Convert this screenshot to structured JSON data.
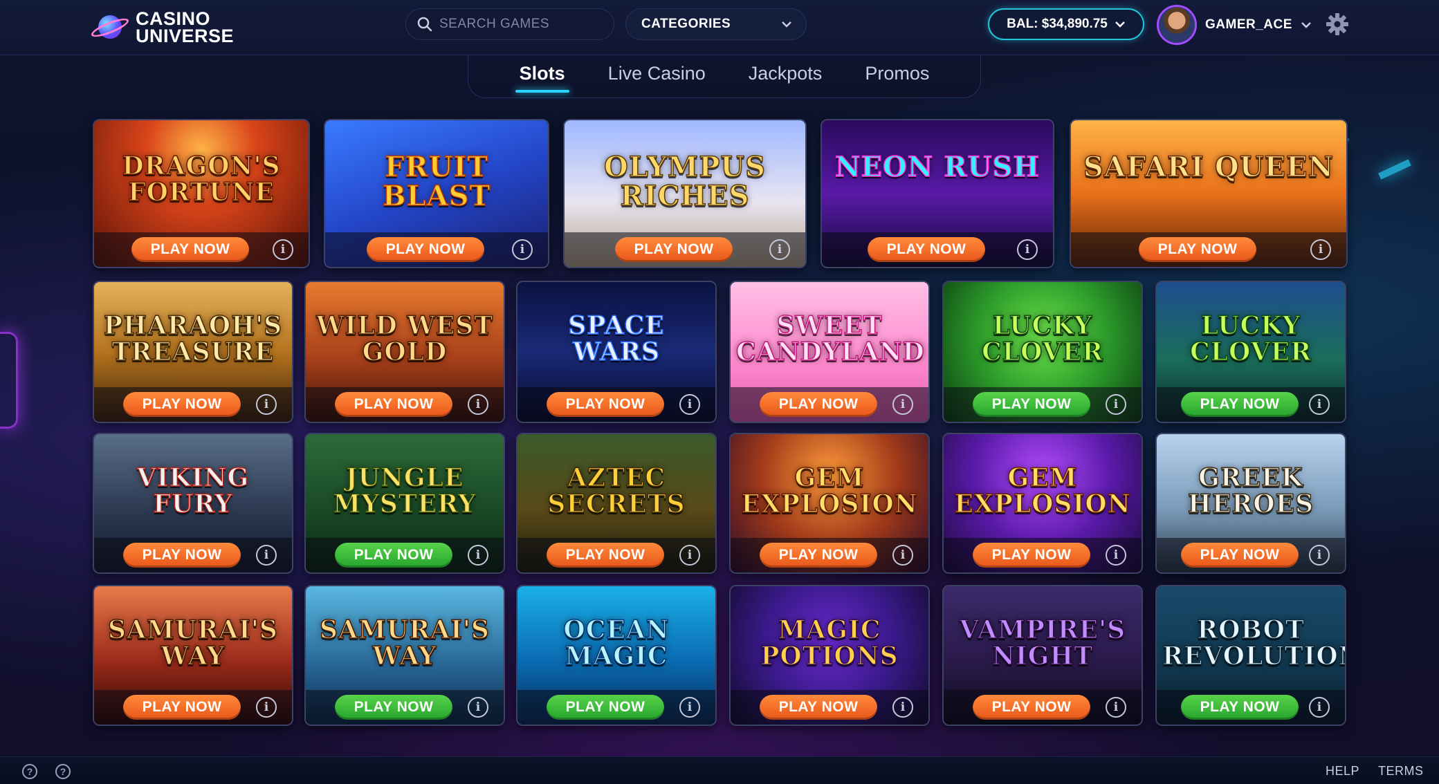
{
  "header": {
    "logo_line1": "CASINO",
    "logo_line2": "UNIVERSE",
    "search_placeholder": "SEARCH GAMES",
    "categories_label": "CATEGORIES",
    "balance": "BAL: $34,890.75",
    "username": "GAMER_ACE"
  },
  "tabs": [
    {
      "label": "Slots",
      "active": true
    },
    {
      "label": "Live Casino",
      "active": false
    },
    {
      "label": "Jackpots",
      "active": false
    },
    {
      "label": "Promos",
      "active": false
    }
  ],
  "games": [
    {
      "title": "DRAGON'S FORTUNE",
      "button": "PLAY NOW",
      "button_color": "orange",
      "theme": "dragon"
    },
    {
      "title": "FRUIT BLAST",
      "button": "PLAY NOW",
      "button_color": "orange",
      "theme": "fruit"
    },
    {
      "title": "OLYMPUS RICHES",
      "button": "PLAY NOW",
      "button_color": "orange",
      "theme": "olympus"
    },
    {
      "title": "NEON RUSH",
      "button": "PLAY NOW",
      "button_color": "orange",
      "theme": "neon"
    },
    {
      "title": "SAFARI QUEEN",
      "button": "PLAY NOW",
      "button_color": "orange",
      "theme": "safari"
    },
    {
      "title": "PHARAOH'S TREASURE",
      "button": "PLAY NOW",
      "button_color": "orange",
      "theme": "pharaoh"
    },
    {
      "title": "WILD WEST GOLD",
      "button": "PLAY NOW",
      "button_color": "orange",
      "theme": "west"
    },
    {
      "title": "SPACE WARS",
      "button": "PLAY NOW",
      "button_color": "orange",
      "theme": "space"
    },
    {
      "title": "SWEET CANDYLAND",
      "button": "PLAY NOW",
      "button_color": "orange",
      "theme": "candy"
    },
    {
      "title": "LUCKY CLOVER",
      "button": "PLAY NOW",
      "button_color": "green",
      "theme": "clover"
    },
    {
      "title": "LUCKY CLOVER",
      "button": "PLAY NOW",
      "button_color": "green",
      "theme": "clover2"
    },
    {
      "title": "VIKING FURY",
      "button": "PLAY NOW",
      "button_color": "orange",
      "theme": "viking"
    },
    {
      "title": "JUNGLE MYSTERY",
      "button": "PLAY NOW",
      "button_color": "green",
      "theme": "jungle"
    },
    {
      "title": "AZTEC SECRETS",
      "button": "PLAY NOW",
      "button_color": "orange",
      "theme": "aztec"
    },
    {
      "title": "GEM EXPLOSION",
      "button": "PLAY NOW",
      "button_color": "orange",
      "theme": "gem"
    },
    {
      "title": "GEM EXPLOSION",
      "button": "PLAY NOW",
      "button_color": "orange",
      "theme": "gem2"
    },
    {
      "title": "GREEK HEROES",
      "button": "PLAY NOW",
      "button_color": "orange",
      "theme": "greek"
    },
    {
      "title": "SAMURAI'S WAY",
      "button": "PLAY NOW",
      "button_color": "orange",
      "theme": "samurai"
    },
    {
      "title": "SAMURAI'S WAY",
      "button": "PLAY NOW",
      "button_color": "green",
      "theme": "samurai2"
    },
    {
      "title": "OCEAN MAGIC",
      "button": "PLAY NOW",
      "button_color": "green",
      "theme": "ocean"
    },
    {
      "title": "MAGIC POTIONS",
      "button": "PLAY NOW",
      "button_color": "orange",
      "theme": "potion"
    },
    {
      "title": "VAMPIRE'S NIGHT",
      "button": "PLAY NOW",
      "button_color": "orange",
      "theme": "vampire"
    },
    {
      "title": "ROBOT REVOLUTION",
      "button": "PLAY NOW",
      "button_color": "green",
      "theme": "robot"
    }
  ],
  "info_glyph": "i",
  "footer": {
    "help": "HELP",
    "terms": "TERMS",
    "icon_glyph": "?"
  },
  "colors": {
    "accent": "#2ad3ff",
    "play_orange": "#ff7a2e",
    "play_green": "#3cc23c"
  }
}
